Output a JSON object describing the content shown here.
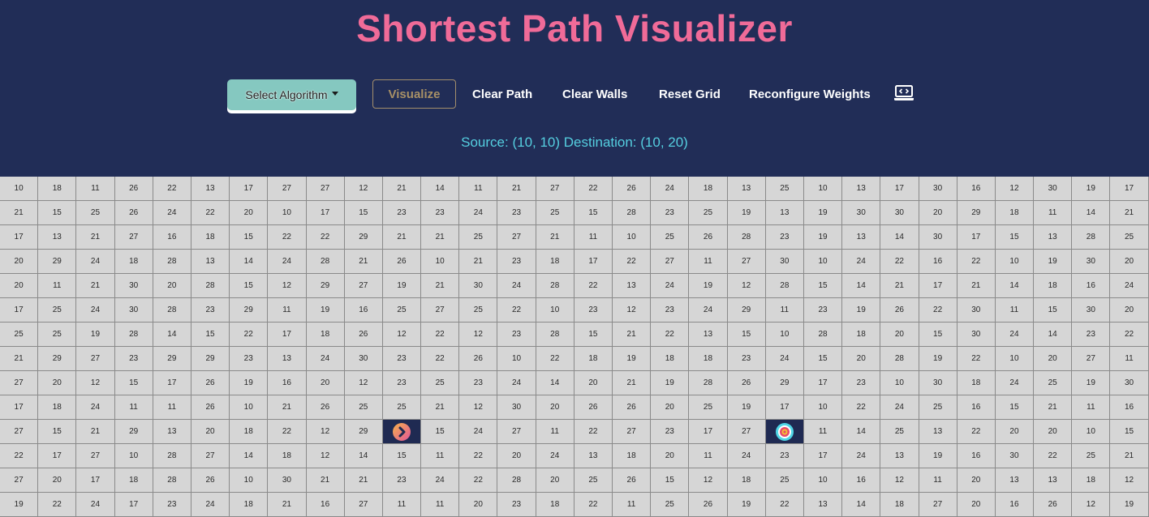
{
  "app": {
    "title": "Shortest Path Visualizer"
  },
  "toolbar": {
    "algorithm_label": "Select Algorithm",
    "visualize_label": "Visualize",
    "clear_path_label": "Clear Path",
    "clear_walls_label": "Clear Walls",
    "reset_grid_label": "Reset Grid",
    "reconfigure_weights_label": "Reconfigure Weights",
    "code_icon": "laptop-code-icon"
  },
  "status": {
    "text": "Source: (10, 10) Destination: (10, 20)"
  },
  "grid": {
    "source": [
      10,
      10
    ],
    "destination": [
      10,
      20
    ],
    "source_icon": "source-chevron-icon",
    "destination_icon": "target-icon",
    "rows": [
      [
        10,
        18,
        11,
        26,
        22,
        13,
        17,
        27,
        27,
        12,
        21,
        14,
        11,
        21,
        27,
        22,
        26,
        24,
        18,
        13,
        25,
        10,
        13,
        17,
        30,
        16,
        12,
        30,
        19,
        17
      ],
      [
        21,
        15,
        25,
        26,
        24,
        22,
        20,
        10,
        17,
        15,
        23,
        23,
        24,
        23,
        25,
        15,
        28,
        23,
        25,
        19,
        13,
        19,
        30,
        30,
        20,
        29,
        18,
        11,
        14,
        21
      ],
      [
        17,
        13,
        21,
        27,
        16,
        18,
        15,
        22,
        22,
        29,
        21,
        21,
        25,
        27,
        21,
        11,
        10,
        25,
        26,
        28,
        23,
        19,
        13,
        14,
        30,
        17,
        15,
        13,
        28,
        25
      ],
      [
        20,
        29,
        24,
        18,
        28,
        13,
        14,
        24,
        28,
        21,
        26,
        10,
        21,
        23,
        18,
        17,
        22,
        27,
        11,
        27,
        30,
        10,
        24,
        22,
        16,
        22,
        10,
        19,
        30,
        20
      ],
      [
        20,
        11,
        21,
        30,
        20,
        28,
        15,
        12,
        29,
        27,
        19,
        21,
        30,
        24,
        28,
        22,
        13,
        24,
        19,
        12,
        28,
        15,
        14,
        21,
        17,
        21,
        14,
        18,
        16,
        24
      ],
      [
        17,
        25,
        24,
        30,
        28,
        23,
        29,
        11,
        19,
        16,
        25,
        27,
        25,
        22,
        10,
        23,
        12,
        23,
        24,
        29,
        11,
        23,
        19,
        26,
        22,
        30,
        11,
        15,
        30,
        20
      ],
      [
        25,
        25,
        19,
        28,
        14,
        15,
        22,
        17,
        18,
        26,
        12,
        22,
        12,
        23,
        28,
        15,
        21,
        22,
        13,
        15,
        10,
        28,
        18,
        20,
        15,
        30,
        24,
        14,
        23,
        22
      ],
      [
        21,
        29,
        27,
        23,
        29,
        29,
        23,
        13,
        24,
        30,
        23,
        22,
        26,
        10,
        22,
        18,
        19,
        18,
        18,
        23,
        24,
        15,
        20,
        28,
        19,
        22,
        10,
        20,
        27,
        11
      ],
      [
        27,
        20,
        12,
        15,
        17,
        26,
        19,
        16,
        20,
        12,
        23,
        25,
        23,
        24,
        14,
        20,
        21,
        19,
        28,
        26,
        29,
        17,
        23,
        10,
        30,
        18,
        24,
        25,
        19,
        30
      ],
      [
        17,
        18,
        24,
        11,
        11,
        26,
        10,
        21,
        26,
        25,
        25,
        21,
        12,
        30,
        20,
        26,
        26,
        20,
        25,
        19,
        17,
        10,
        22,
        24,
        25,
        16,
        15,
        21,
        11,
        16
      ],
      [
        27,
        15,
        21,
        29,
        13,
        20,
        18,
        22,
        12,
        29,
        "",
        15,
        24,
        27,
        11,
        22,
        27,
        23,
        17,
        27,
        "",
        11,
        14,
        25,
        13,
        22,
        20,
        20,
        10,
        15
      ],
      [
        22,
        17,
        27,
        10,
        28,
        27,
        14,
        18,
        12,
        14,
        15,
        11,
        22,
        20,
        24,
        13,
        18,
        20,
        11,
        24,
        23,
        17,
        24,
        13,
        19,
        16,
        30,
        22,
        25,
        21
      ],
      [
        27,
        20,
        17,
        18,
        28,
        26,
        10,
        30,
        21,
        21,
        23,
        24,
        22,
        28,
        20,
        25,
        26,
        15,
        12,
        18,
        25,
        10,
        16,
        12,
        11,
        20,
        13,
        13,
        18,
        12
      ],
      [
        19,
        22,
        24,
        17,
        23,
        24,
        18,
        21,
        16,
        27,
        11,
        11,
        20,
        23,
        18,
        22,
        11,
        25,
        26,
        19,
        22,
        13,
        14,
        18,
        27,
        20,
        16,
        26,
        12,
        19
      ]
    ]
  },
  "colors": {
    "header_bg": "#212d57",
    "title": "#f06b98",
    "accent_teal": "#85c8c0",
    "status_text": "#55cfe0",
    "cell_bg": "#d6d6d6"
  }
}
